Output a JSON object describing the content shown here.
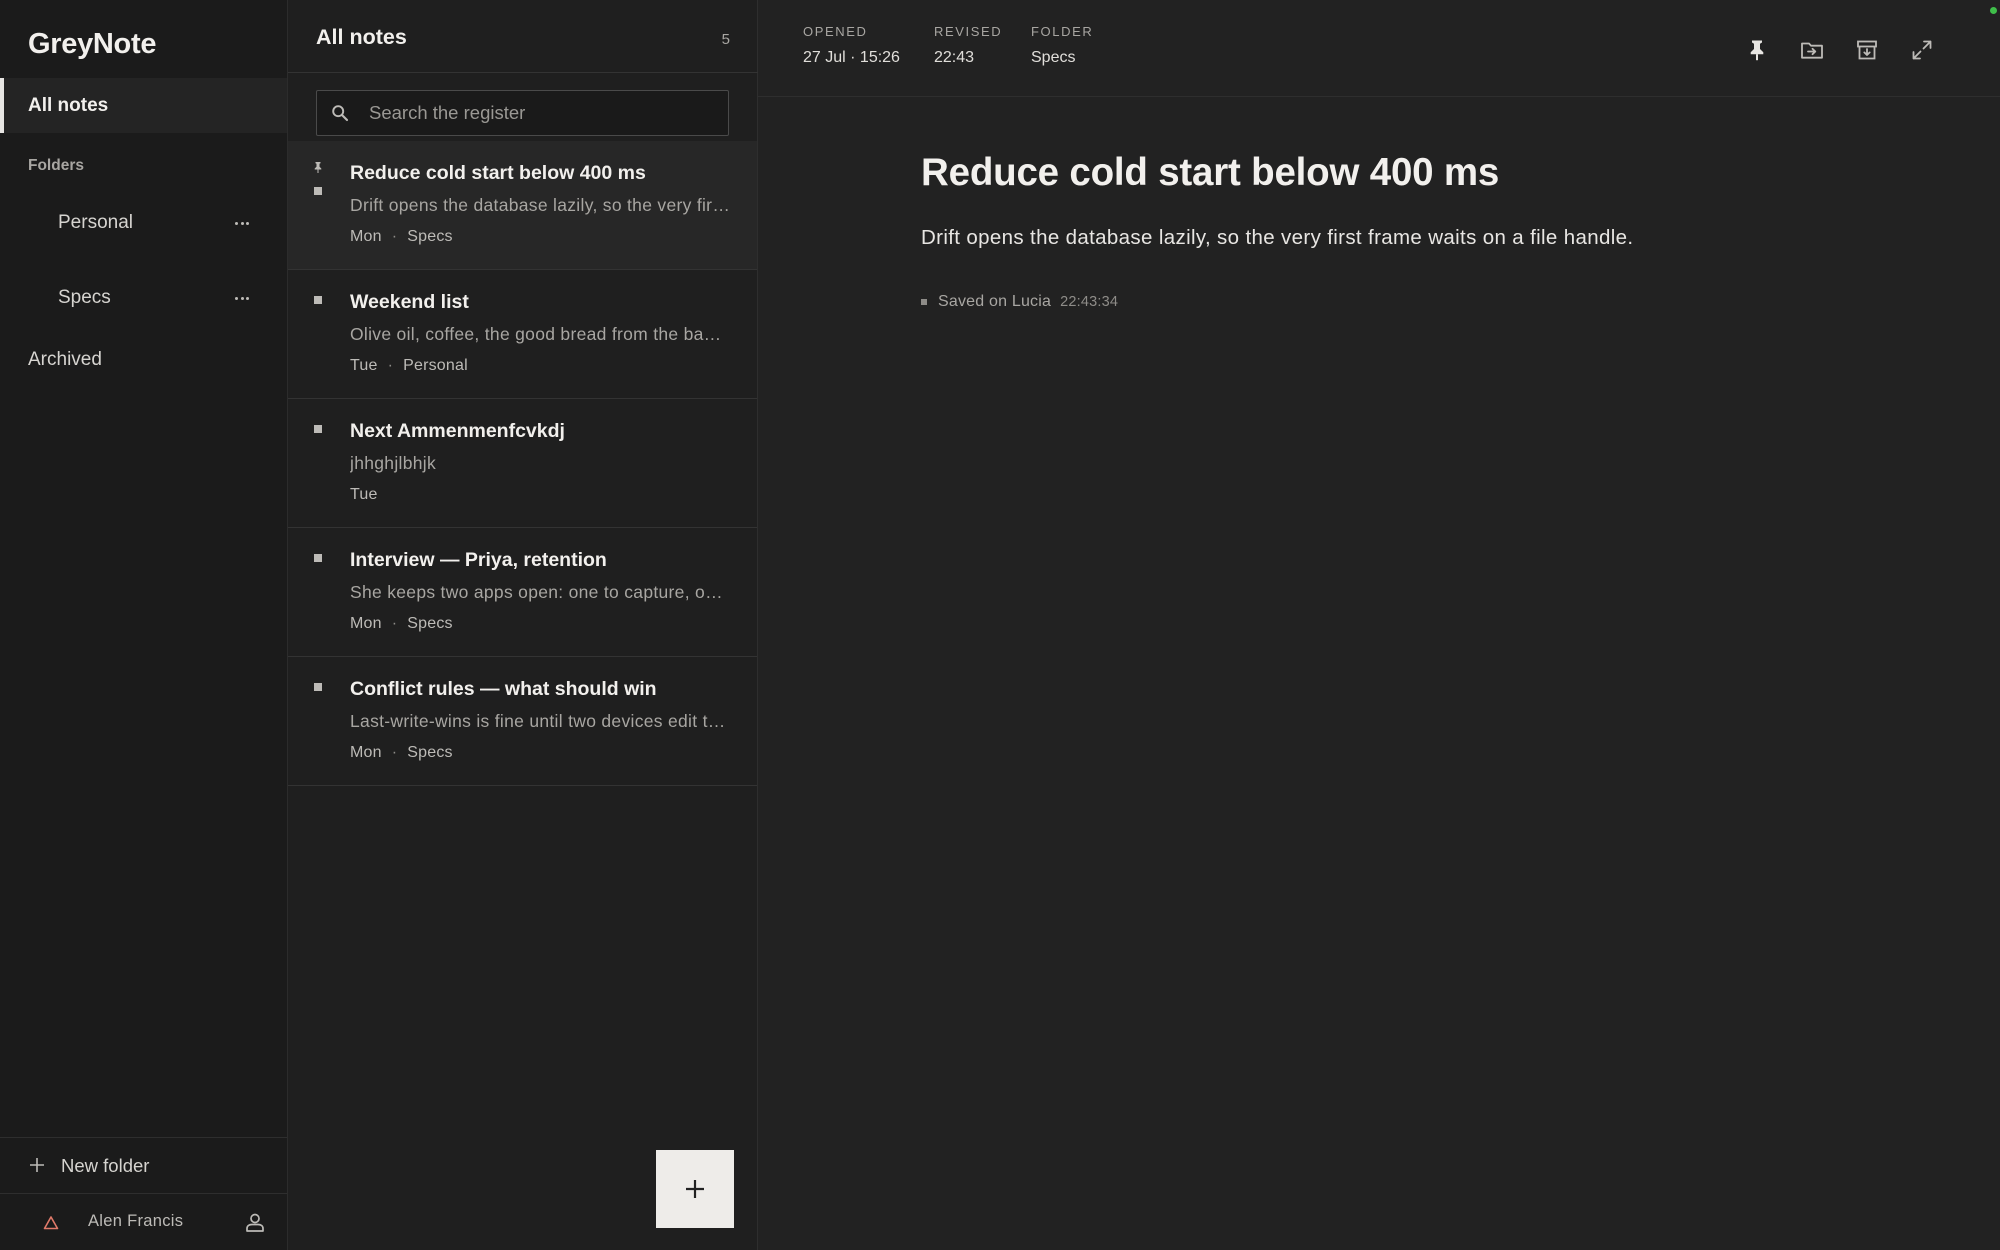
{
  "app": {
    "name": "GreyNote"
  },
  "sidebar": {
    "all_notes_label": "All notes",
    "folders_heading": "Folders",
    "folders": [
      {
        "label": "Personal"
      },
      {
        "label": "Specs"
      }
    ],
    "archived_label": "Archived",
    "new_folder_label": "New folder",
    "user_name": "Alen Francis"
  },
  "list": {
    "title": "All notes",
    "count": "5",
    "search_placeholder": "Search the register",
    "notes": [
      {
        "title": "Reduce cold start below 400 ms",
        "preview": "Drift opens the database lazily, so the very first frame waits on a file handle.",
        "day": "Mon",
        "folder": "Specs",
        "pinned": true,
        "selected": true
      },
      {
        "title": "Weekend list",
        "preview": "Olive oil, coffee, the good bread from the bakery.",
        "day": "Tue",
        "folder": "Personal",
        "pinned": false,
        "selected": false
      },
      {
        "title": "Next Ammenmenfcvkdj",
        "preview": "jhhghjlbhjk",
        "day": "Tue",
        "folder": "",
        "pinned": false,
        "selected": false
      },
      {
        "title": "Interview — Priya, retention",
        "preview": "She keeps two apps open: one to capture, one to organise.",
        "day": "Mon",
        "folder": "Specs",
        "pinned": false,
        "selected": false
      },
      {
        "title": "Conflict rules — what should win",
        "preview": "Last-write-wins is fine until two devices edit the same note.",
        "day": "Mon",
        "folder": "Specs",
        "pinned": false,
        "selected": false
      }
    ]
  },
  "editor": {
    "meta": {
      "opened_label": "OPENED",
      "opened_value": "27 Jul · 15:26",
      "revised_label": "REVISED",
      "revised_value": "22:43",
      "folder_label": "FOLDER",
      "folder_value": "Specs"
    },
    "title": "Reduce cold start below 400 ms",
    "body": "Drift opens the database lazily, so the very first frame waits on a file handle.",
    "saved_text": "Saved on Lucia",
    "saved_time": "22:43:34"
  },
  "colors": {
    "accent": "#eeece9",
    "warning": "#e07a6a",
    "status_online": "#3fbf4a"
  }
}
